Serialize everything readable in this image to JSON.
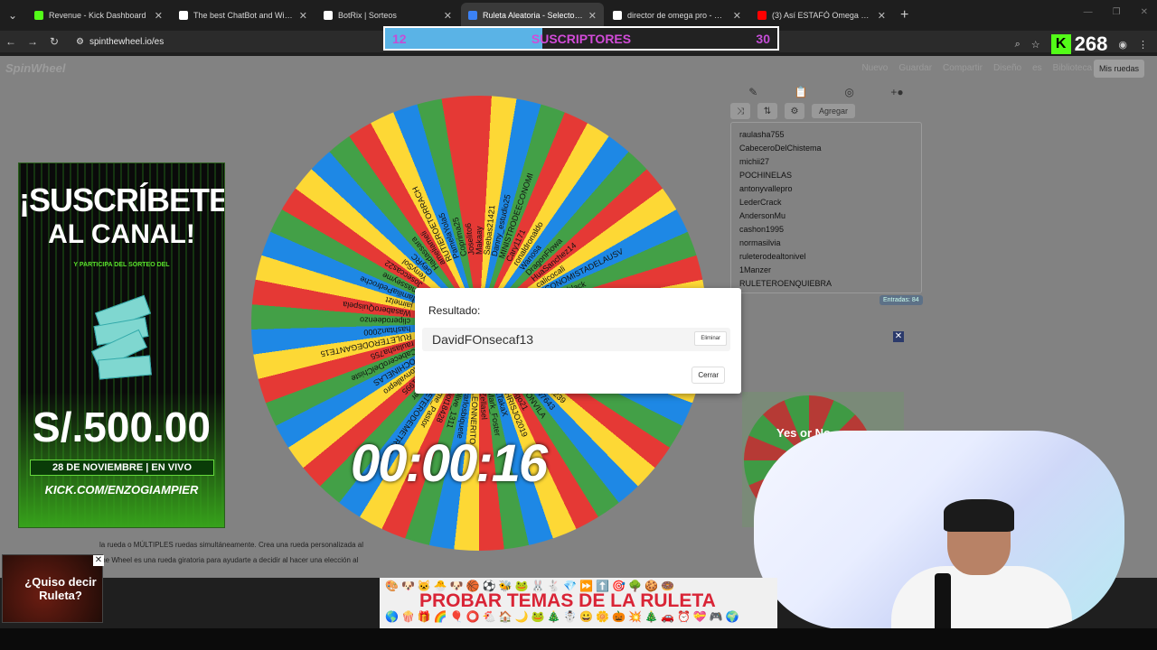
{
  "browser": {
    "tabs": [
      {
        "title": "Revenue - Kick Dashboard",
        "color": "#53fc18",
        "active": false
      },
      {
        "title": "The best ChatBot and Widgets",
        "color": "#ffffff",
        "active": false
      },
      {
        "title": "BotRix | Sorteos",
        "color": "#ffffff",
        "active": false
      },
      {
        "title": "Ruleta Aleatoria - Selector Pers",
        "color": "#3b82f6",
        "active": true
      },
      {
        "title": "director de omega pro - Buscar",
        "color": "#ffffff",
        "active": false
      },
      {
        "title": "(3) Así ESTAFÓ Omega Pro a Su",
        "color": "#ff0000",
        "active": false
      }
    ],
    "url": "spinthewheel.io/es"
  },
  "overlay": {
    "sub_current": "12",
    "sub_label": "SUSCRIPTORES",
    "sub_goal": "30",
    "sub_progress": 0.4,
    "kick_viewers": "268"
  },
  "site": {
    "brand": "SpinWheel",
    "menu": [
      "Nuevo",
      "Guardar",
      "Compartir",
      "Diseño",
      "es",
      "Biblioteca"
    ],
    "my_wheels": "Mis ruedas",
    "add_label": "Agregar",
    "entries_count": "Entradas: 84",
    "entries": [
      "raulasha755",
      "CabeceroDelChistema",
      "michii27",
      "POCHINELAS",
      "antonyvallepro",
      "LederCrack",
      "AndersonMu",
      "cashon1995",
      "normasilvia",
      "ruleterodealtonivel",
      "1Manzer",
      "RULETEROENQUIEBRA"
    ]
  },
  "wheel": {
    "colors": [
      "#e53935",
      "#fdd835",
      "#1e88e5",
      "#43a047"
    ],
    "names": [
      "Makaay",
      "Saebas21421",
      "Danny_estudio25",
      "MINISTRODEECONOMI",
      "Cary1171",
      "ronaldronaldo",
      "Wanosa",
      "DragonFlowa",
      "HuaSanchez14",
      "calicocali",
      "ECONOMISTADELAUSV",
      "senseyblack",
      "Frata15",
      "alexzrdm",
      "Davidsanchez2000",
      "nora3120",
      "Celesteacosta",
      "comisiondelosrule",
      "Guillermou_01",
      "SUMASTOR",
      "michael",
      "Larasha1239",
      "andrew7643",
      "ANTONVILA",
      "robgo21",
      "CHRISJO2019",
      "XTakaX",
      "Mark_Foster",
      "Zellasel",
      "LEONNERITO",
      "carlosbiquete",
      "Olive_1311",
      "Eliot18428",
      "Heme_Pastor",
      "RULETERODEMETROPOL",
      "1Manzer",
      "flyyc1995",
      "antonvallepro",
      "POCHINELAS",
      "CabeceroDelChiste",
      "raulasha755",
      "RULETERODEGANTE15",
      "hashtan2000",
      "cliperodeenzo",
      "WasaberoQuispela",
      "jaimelzt",
      "familiaPedroche",
      "masseyme",
      "Joseccas22",
      "YenySol",
      "GeyRC",
      "Hadassara",
      "ameliameli",
      "RUTIEROETORRACH",
      "PamelaYola5",
      "Coprima25",
      "Joselito6"
    ]
  },
  "timer": "00:00:16",
  "dialog": {
    "title": "Resultado:",
    "winner": "DavidFOnsecaf13",
    "remove_label": "Eliminar",
    "close_label": "Cerrar"
  },
  "ad_left": {
    "title1": "¡SUSCRÍBETE",
    "title2": "AL CANAL!",
    "subtitle": "Y PARTICIPA DEL SORTEO DEL",
    "price": "S/.500.00",
    "date": "28 DE NOVIEMBRE | EN VIVO",
    "url": "KICK.COM/ENZOGIAMPIER"
  },
  "ad_right": {
    "text": "Yes or No",
    "close": "✕"
  },
  "footer": {
    "line1": "la rueda o MÚLTIPLES ruedas simultáneamente. Crea una rueda personalizada al",
    "line2": "the Wheel es una rueda giratoria para ayudarte a decidir al hacer una elección al"
  },
  "promo": {
    "title": "PROBAR TEMAS DE LA RULETA",
    "emojis_top": "🎨🐶🐱🐣🐶🏀⚽🐝🐸🐰🐇💎⏩⬆️🎯🌳🍪🍩",
    "emojis_bottom": "🌎🍿🎁🌈🎈⭕🐔🏠🌙🐸🎄☃️😀🌼🎃💥🎄🚗⏰💝🎮🌍"
  },
  "roulette_ad": {
    "text": "¿Quiso decir Ruleta?",
    "close": "✕"
  }
}
